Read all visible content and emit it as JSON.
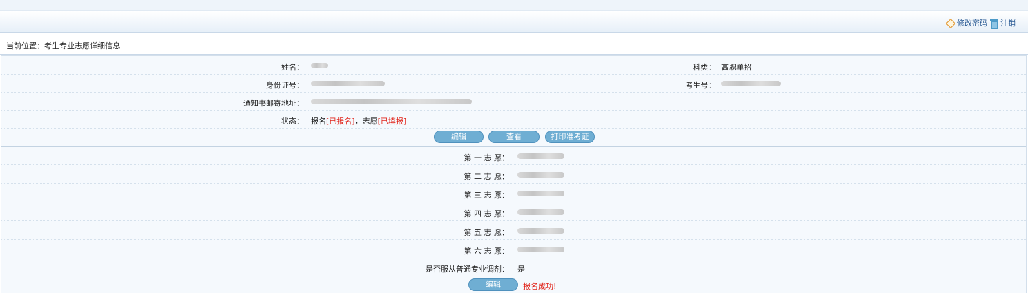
{
  "toolbar": {
    "change_password": "修改密码",
    "logout": "注销",
    "icons": [
      "diamond-icon",
      "trash-icon"
    ]
  },
  "breadcrumb": "当前位置：考生专业志愿详细信息",
  "info": {
    "name_label": "姓名：",
    "category_label": "科类：",
    "category_value": "高职单招",
    "id_label": "身份证号：",
    "exam_no_label": "考生号：",
    "address_label": "通知书邮寄地址：",
    "status_label": "状态：",
    "status_reg": "报名",
    "status_reg_state": "[已报名]",
    "status_sep": "，",
    "status_pref": "志愿",
    "status_pref_state": "[已填报]"
  },
  "buttons": {
    "edit": "编辑",
    "view": "查看",
    "print_ticket": "打印准考证"
  },
  "preferences": [
    {
      "label": "第 一 志 愿："
    },
    {
      "label": "第 二 志 愿："
    },
    {
      "label": "第 三 志 愿："
    },
    {
      "label": "第 四 志 愿："
    },
    {
      "label": "第 五 志 愿："
    },
    {
      "label": "第 六 志 愿："
    }
  ],
  "adjust": {
    "label": "是否服从普通专业调剂：",
    "value": "是"
  },
  "footer": {
    "edit": "编辑",
    "success": "报名成功!"
  },
  "colors": {
    "accent": "#6faed3",
    "status_red": "#e1251b",
    "link": "#2c5c95"
  }
}
